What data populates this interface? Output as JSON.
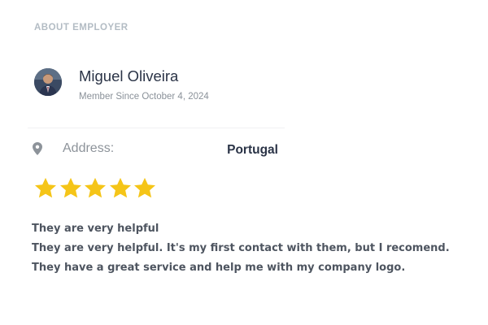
{
  "section": {
    "title": "ABOUT EMPLOYER"
  },
  "employer": {
    "name": "Miguel Oliveira",
    "member_since": "Member Since October 4, 2024",
    "avatar_icon": "profile-photo"
  },
  "address": {
    "icon": "map-pin-icon",
    "label": "Address:",
    "value": "Portugal"
  },
  "rating": {
    "stars": 5,
    "max_stars": 5,
    "star_color": "#f5c518"
  },
  "review": {
    "lines": [
      "They are very helpful",
      "They are very helpful. It's my first contact with them, but I recomend.",
      "They have a great service and help me with my company logo."
    ]
  },
  "colors": {
    "title": "#b3bcc4",
    "name": "#2a3346",
    "muted": "#8a9199",
    "review_text": "#4e5560"
  }
}
